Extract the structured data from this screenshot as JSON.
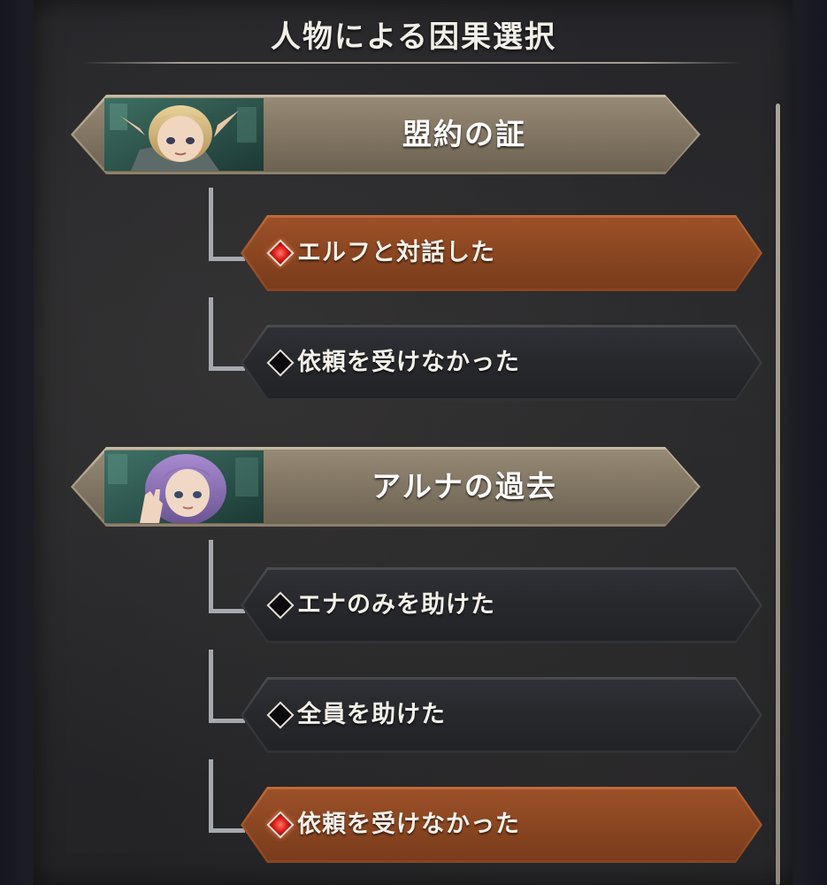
{
  "screen": {
    "title": "人物による因果選択"
  },
  "groups": [
    {
      "label": "盟約の証",
      "portrait": "elf-girl-portrait",
      "options": [
        {
          "label": "エルフと対話した",
          "selected": true
        },
        {
          "label": "依頼を受けなかった",
          "selected": false
        }
      ]
    },
    {
      "label": "アルナの過去",
      "portrait": "purple-haired-girl-portrait",
      "options": [
        {
          "label": "エナのみを助けた",
          "selected": false
        },
        {
          "label": "全員を助けた",
          "selected": false
        },
        {
          "label": "依頼を受けなかった",
          "selected": true
        }
      ]
    }
  ],
  "colors": {
    "selected_accent": "#a5552c",
    "unselected_bg": "#27282c",
    "header_bg": "#978a76",
    "gem_selected": "#e0201a"
  }
}
